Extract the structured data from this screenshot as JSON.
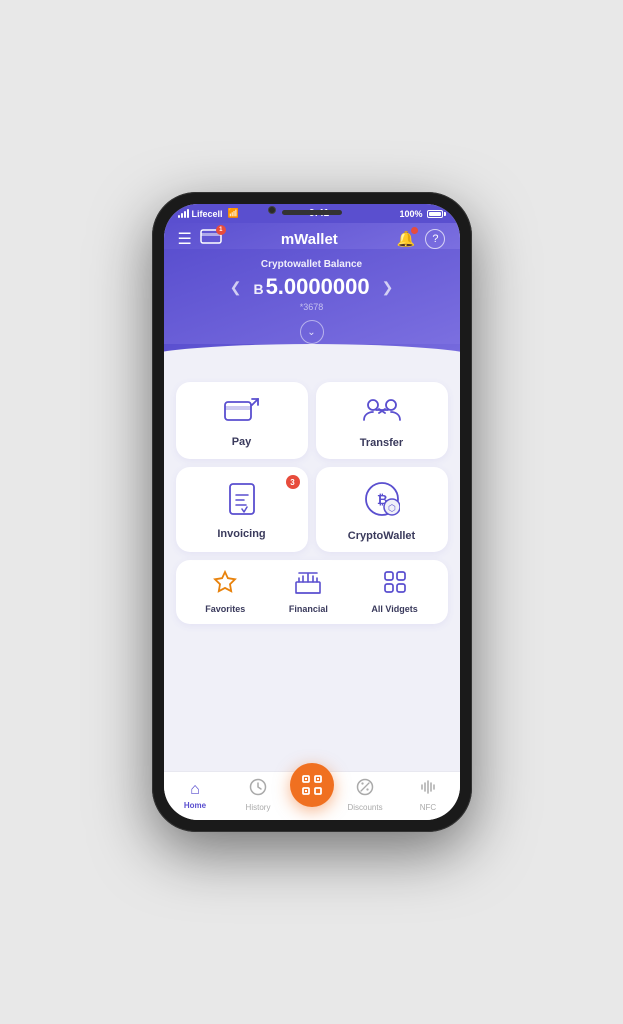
{
  "status_bar": {
    "carrier": "Lifecell",
    "time": "9:41",
    "battery": "100%"
  },
  "header": {
    "title": "mWallet",
    "help_label": "?"
  },
  "balance": {
    "label": "Cryptowallet Balance",
    "currency_symbol": "B",
    "amount": "5.0000000",
    "account": "*3678"
  },
  "cards": [
    {
      "id": "pay",
      "label": "Pay",
      "icon": "pay-icon",
      "badge": null
    },
    {
      "id": "transfer",
      "label": "Transfer",
      "icon": "transfer-icon",
      "badge": null
    },
    {
      "id": "invoicing",
      "label": "Invoicing",
      "icon": "invoicing-icon",
      "badge": "3"
    },
    {
      "id": "cryptowallet",
      "label": "CryptoWallet",
      "icon": "cryptowallet-icon",
      "badge": null
    }
  ],
  "quick_actions": [
    {
      "id": "favorites",
      "label": "Favorites",
      "icon": "star-icon",
      "color": "orange"
    },
    {
      "id": "financial",
      "label": "Financial",
      "icon": "bank-icon",
      "color": "purple"
    },
    {
      "id": "all_widgets",
      "label": "All Vidgets",
      "icon": "grid-icon",
      "color": "purple"
    }
  ],
  "nav": {
    "items": [
      {
        "id": "home",
        "label": "Home",
        "active": true
      },
      {
        "id": "history",
        "label": "History",
        "active": false
      },
      {
        "id": "scan",
        "label": "",
        "active": false,
        "center": true
      },
      {
        "id": "discounts",
        "label": "Discounts",
        "active": false
      },
      {
        "id": "nfc",
        "label": "NFC",
        "active": false
      }
    ]
  }
}
